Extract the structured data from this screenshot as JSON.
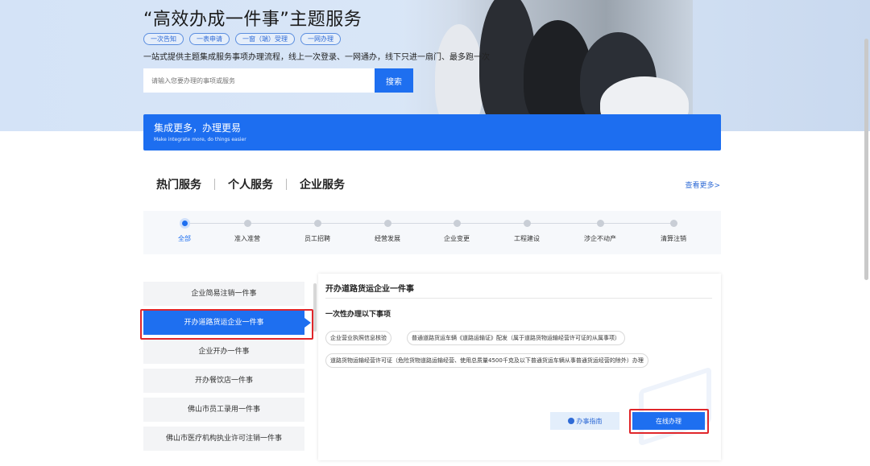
{
  "hero": {
    "title": "“高效办成一件事”主题服务",
    "tags": [
      "一次告知",
      "一表申请",
      "一窗（端）受理",
      "一网办理"
    ],
    "description": "一站式提供主题集成服务事项办理流程，线上一次登录、一网通办，线下只进一扇门、最多跑一次",
    "search": {
      "placeholder": "请输入您要办理的事项或服务",
      "button_label": "搜索"
    }
  },
  "banner": {
    "title": "集成更多，办理更易",
    "subtitle": "Make integrate more, do things easier"
  },
  "category_tabs": [
    "热门服务",
    "个人服务",
    "企业服务"
  ],
  "view_more": "查看更多>",
  "stepper": {
    "active_index": 0,
    "steps": [
      "全部",
      "准入准营",
      "员工招聘",
      "经营发展",
      "企业变更",
      "工程建设",
      "涉企不动产",
      "清算注销"
    ]
  },
  "service_list": {
    "selected_index": 1,
    "items": [
      "企业简易注销一件事",
      "开办道路货运企业一件事",
      "企业开办一件事",
      "开办餐饮店一件事",
      "佛山市员工录用一件事",
      "佛山市医疗机构执业许可注销一件事"
    ]
  },
  "detail": {
    "title": "开办道路货运企业一件事",
    "subtitle": "一次性办理以下事项",
    "items": [
      "企业营业执照信息核验",
      "普通道路货运车辆《道路运输证》配发（属于道路货物运输经营许可证的从属事项）",
      "道路货物运输经营许可证（危险货物道路运输经营、使用总质量4500千克及以下普通货运车辆从事普通货运经营的除外）办理"
    ],
    "guide_button": "办事指南",
    "online_button": "在线办理"
  },
  "colors": {
    "primary": "#1e6ff0",
    "highlight": "#e0262b",
    "hero_bg": "#d9e6f7"
  }
}
